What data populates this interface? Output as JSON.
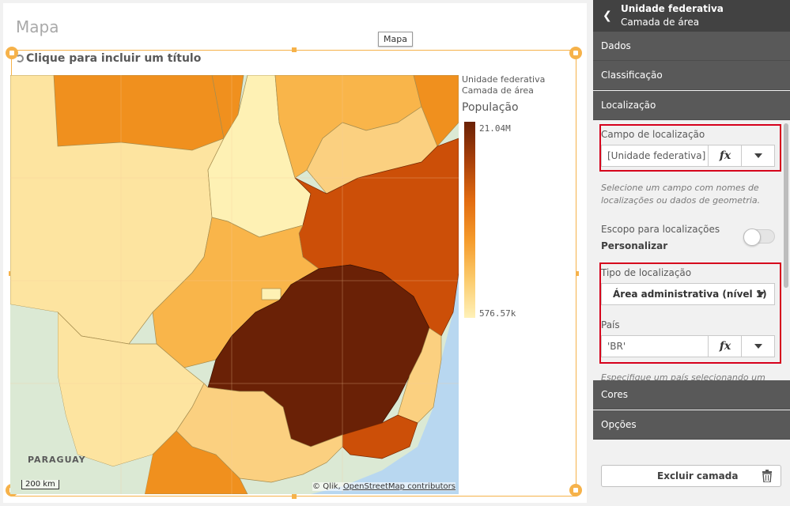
{
  "sheet": {
    "title": "Mapa",
    "tooltip": "Mapa",
    "object_title_placeholder": "Clique para incluir um título"
  },
  "map": {
    "credit_prefix": "© Qlik,",
    "credit_link": "OpenStreetMap contributors",
    "scale_label": "200 km",
    "country_label": "PARAGUAY",
    "colors": {
      "darkest": "#6a2106",
      "dark": "#cc4f08",
      "mid": "#f0901e",
      "light": "#f9b54a",
      "lighter": "#fbd080",
      "lightest": "#fef1b4",
      "ocean": "#b8d7f0",
      "land": "#dbe9d4"
    }
  },
  "legend": {
    "header_1": "Unidade federativa",
    "header_2": "Camada de área",
    "title": "População",
    "max_label": "21.04M",
    "min_label": "576.57k"
  },
  "panel": {
    "header_title": "Unidade federativa",
    "header_subtitle": "Camada de área",
    "sections": {
      "dados": "Dados",
      "classificacao": "Classificação",
      "localizacao": "Localização",
      "cores": "Cores",
      "opcoes": "Opções"
    },
    "location_field": {
      "label": "Campo de localização",
      "value": "[Unidade federativa]",
      "fx": "fx"
    },
    "hint_1": "Selecione um campo com nomes de localizações ou dados de geometria.",
    "scope": {
      "label": "Escopo para localizações",
      "value": "Personalizar"
    },
    "location_type": {
      "label": "Tipo de localização",
      "value": "Área administrativa (nível 1)"
    },
    "country": {
      "label": "País",
      "value": "'BR'",
      "fx": "fx"
    },
    "hint_2": "Especifique um país selecionando um",
    "delete_button": "Excluir camada"
  }
}
